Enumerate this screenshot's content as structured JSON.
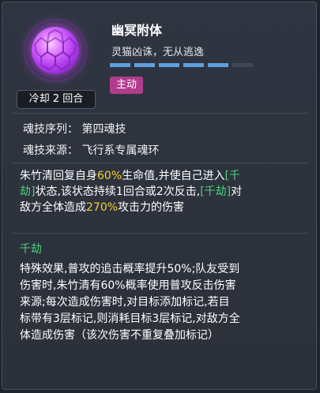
{
  "skill": {
    "title": "幽冥附体",
    "subtitle": "灵猫凶诛，无从逃逸",
    "cooldown": "冷却 2 回合",
    "tag": "主动",
    "pips_filled": 5,
    "pips_total": 6,
    "icon": "purple-orb-icon"
  },
  "info": {
    "order": "魂技序列： 第四魂技",
    "source": "魂技来源： 飞行系专属魂环"
  },
  "description": {
    "p1": "朱竹清回复自身",
    "v1": "60%",
    "p2": "生命值,并使自己进入",
    "k1a": "[千",
    "k1b": "劫]",
    "p3": "状态,该状态持续1回合或2次反击,",
    "k2": "[千劫]",
    "p4": "对",
    "p5": "敌方全体造成",
    "v2": "270%",
    "p6": "攻击力的伤害"
  },
  "effect": {
    "name": "千劫",
    "lines": [
      "特殊效果,普攻的追击概率提升50%;队友受到",
      "伤害时,朱竹清有60%概率使用普攻反击伤害",
      "来源;每次造成伤害时,对目标添加标记,若目",
      "标带有3层标记,则消耗目标3层标记,对敌方全",
      "体造成伤害（该次伤害不重复叠加标记）"
    ]
  },
  "colors": {
    "highlight_value": "#f3d13a",
    "highlight_keyword": "#4bd17a",
    "tag_bg": "#b23c8c",
    "pip": "#5fa0e0"
  }
}
